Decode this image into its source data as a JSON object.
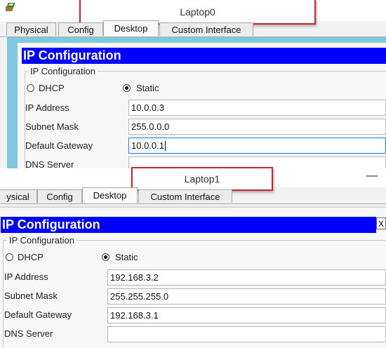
{
  "windows": [
    {
      "title": "Laptop0",
      "tabs": [
        "Physical",
        "Config",
        "Desktop",
        "Custom Interface"
      ],
      "active_tab": "Desktop",
      "panel_title": "IP Configuration",
      "group_label": "IP Configuration",
      "dhcp_label": "DHCP",
      "static_label": "Static",
      "selected_mode": "Static",
      "fields": [
        {
          "label": "IP Address",
          "value": "10.0.0.3"
        },
        {
          "label": "Subnet Mask",
          "value": "255.0.0.0"
        },
        {
          "label": "Default Gateway",
          "value": "10.0.0.1"
        },
        {
          "label": "DNS Server",
          "value": ""
        }
      ]
    },
    {
      "title": "Laptop1",
      "tabs": [
        "ysical",
        "Config",
        "Desktop",
        "Custom Interface"
      ],
      "active_tab": "Desktop",
      "panel_title": "IP Configuration",
      "close_glyph": "X",
      "minimize_glyph": "—",
      "group_label": "IP Configuration",
      "dhcp_label": "DHCP",
      "static_label": "Static",
      "selected_mode": "Static",
      "fields": [
        {
          "label": "IP Address",
          "value": "192.168.3.2"
        },
        {
          "label": "Subnet Mask",
          "value": "255.255.255.0"
        },
        {
          "label": "Default Gateway",
          "value": "192.168.3.1"
        },
        {
          "label": "DNS Server",
          "value": ""
        }
      ]
    }
  ],
  "colors": {
    "ip_bar": "#0000ff",
    "frame": "#7fc9de",
    "title_highlight": "#c0282d"
  },
  "icons": {
    "app": "packet-tracer-app-icon",
    "minimize": "minimize-icon",
    "close": "close-icon"
  }
}
